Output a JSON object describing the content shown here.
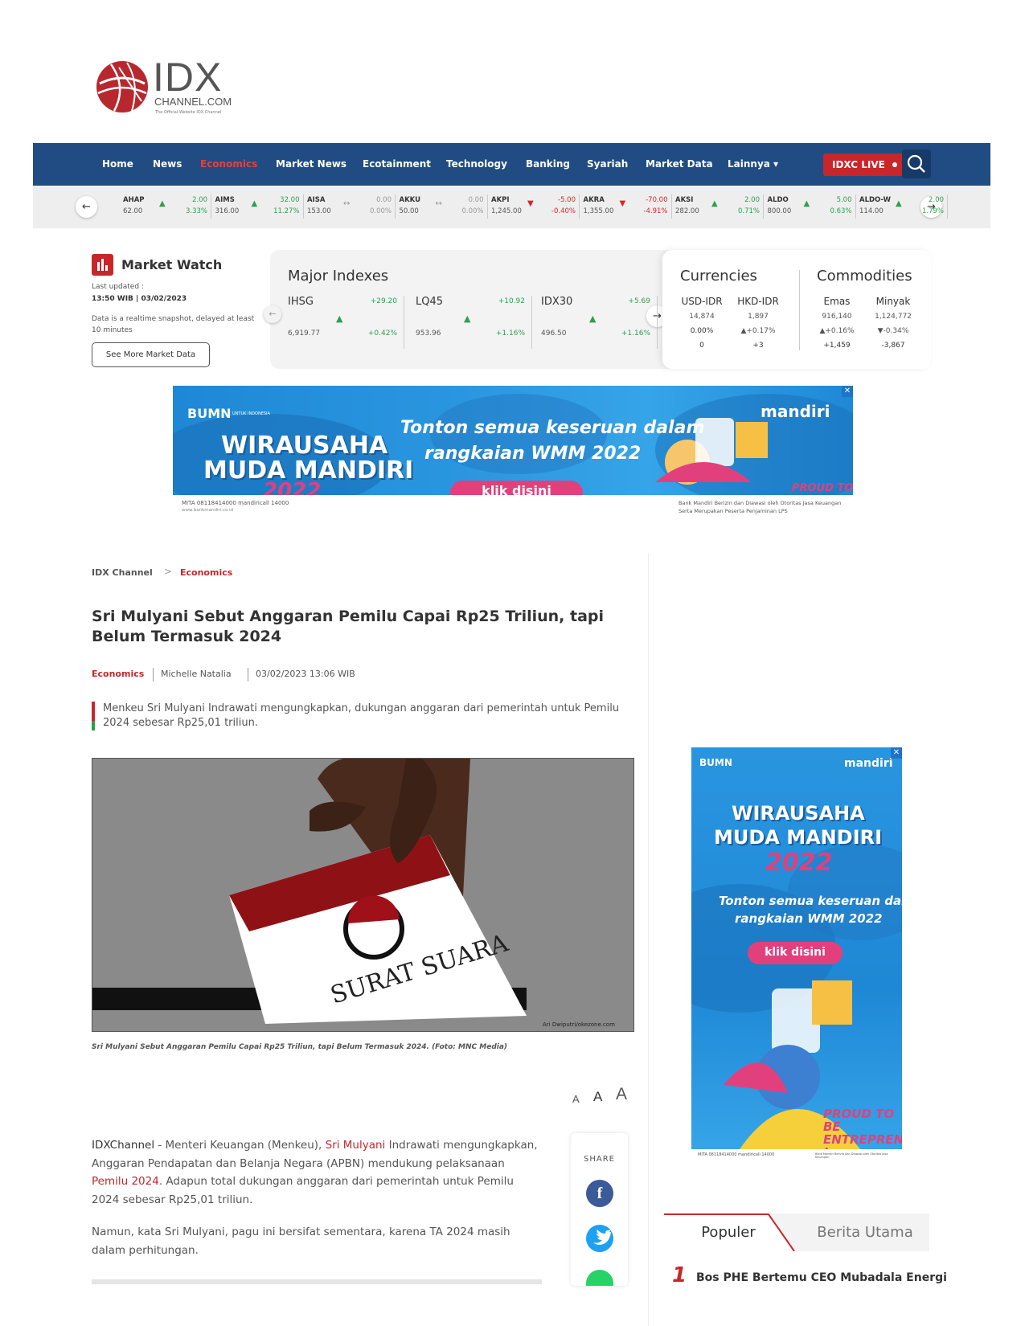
{
  "logo": {
    "main": "IDX",
    "sub": "CHANNEL.COM",
    "tagline": "The Official Website IDX Channel"
  },
  "nav": {
    "items": [
      {
        "label": "Home",
        "active": false
      },
      {
        "label": "News",
        "active": false
      },
      {
        "label": "Economics",
        "active": true
      },
      {
        "label": "Market News",
        "active": false
      },
      {
        "label": "Ecotainment",
        "active": false
      },
      {
        "label": "Technology",
        "active": false
      },
      {
        "label": "Banking",
        "active": false
      },
      {
        "label": "Syariah",
        "active": false
      },
      {
        "label": "Market Data",
        "active": false
      },
      {
        "label": "Lainnya ▾",
        "active": false
      }
    ],
    "live_label": "IDXC LIVE",
    "search_icon": "search-icon"
  },
  "ticker": [
    {
      "code": "AHAP",
      "price": "62.00",
      "change": "2.00",
      "pct": "3.33%",
      "dir": "up"
    },
    {
      "code": "AIMS",
      "price": "316.00",
      "change": "32.00",
      "pct": "11.27%",
      "dir": "up"
    },
    {
      "code": "AISA",
      "price": "153.00",
      "change": "0.00",
      "pct": "0.00%",
      "dir": "flat"
    },
    {
      "code": "AKKU",
      "price": "50.00",
      "change": "0.00",
      "pct": "0.00%",
      "dir": "flat"
    },
    {
      "code": "AKPI",
      "price": "1,245.00",
      "change": "-5.00",
      "pct": "-0.40%",
      "dir": "down"
    },
    {
      "code": "AKRA",
      "price": "1,355.00",
      "change": "-70.00",
      "pct": "-4.91%",
      "dir": "down"
    },
    {
      "code": "AKSI",
      "price": "282.00",
      "change": "2.00",
      "pct": "0.71%",
      "dir": "up"
    },
    {
      "code": "ALDO",
      "price": "800.00",
      "change": "5.00",
      "pct": "0.63%",
      "dir": "up"
    },
    {
      "code": "ALDO-W",
      "price": "114.00",
      "change": "2.00",
      "pct": "1.79%",
      "dir": "up"
    }
  ],
  "market_watch": {
    "title": "Market Watch",
    "last_updated_label": "Last updated :",
    "last_updated": "13:50 WIB | 03/02/2023",
    "note": "Data is a realtime snapshot, delayed at least 10 minutes",
    "button": "See More Market Data"
  },
  "major_indexes": {
    "title": "Major Indexes",
    "items": [
      {
        "name": "IHSG",
        "change": "+29.20",
        "value": "6,919.77",
        "pct": "+0.42%"
      },
      {
        "name": "LQ45",
        "change": "+10.92",
        "value": "953.96",
        "pct": "+1.16%"
      },
      {
        "name": "IDX30",
        "change": "+5.69",
        "value": "496.50",
        "pct": "+1.16%"
      }
    ]
  },
  "currencies": {
    "title": "Currencies",
    "items": [
      {
        "name": "USD-IDR",
        "value": "14,874",
        "pct": "0.00%",
        "change": "0",
        "dir": "flat"
      },
      {
        "name": "HKD-IDR",
        "value": "1,897",
        "pct": "+0.17%",
        "change": "+3",
        "dir": "up"
      }
    ]
  },
  "commodities": {
    "title": "Commodities",
    "items": [
      {
        "name": "Emas",
        "value": "916,140",
        "pct": "+0.16%",
        "change": "+1,459",
        "dir": "up"
      },
      {
        "name": "Minyak",
        "value": "1,124,772",
        "pct": "-0.34%",
        "change": "-3,867",
        "dir": "down"
      }
    ]
  },
  "ad": {
    "brand": "BUMN",
    "brand_sub": "UNTUK INDONESIA",
    "bank": "mandiri",
    "title1": "WIRAUSAHA",
    "title2": "MUDA MANDIRI",
    "year": "2022",
    "tagline1": "Tonton semua keseruan dalam",
    "tagline2": "rangkaian WMM 2022",
    "cta": "klik disini",
    "footer_left": "MITA 08118414000   mandiricall 14000",
    "footer_web": "www.bankmandiri.co.id",
    "footer_right1": "Bank Mandiri Berizin dan Diawasi oleh Otoritas Jasa Keuangan",
    "footer_right2": "Serta Merupakan Peserta Penjaminan LPS",
    "close": "✕",
    "slogan": "PROUD TO BE ENTREPRENEUR !"
  },
  "breadcrumb": {
    "home": "IDX Channel",
    "sep": ">",
    "category": "Economics"
  },
  "article": {
    "title": "Sri Mulyani Sebut Anggaran Pemilu Capai Rp25 Triliun, tapi Belum Termasuk 2024",
    "category": "Economics",
    "author": "Michelle Natalia",
    "date": "03/02/2023 13:06 WIB",
    "lead": "Menkeu Sri Mulyani Indrawati mengungkapkan, dukungan anggaran dari pemerintah untuk Pemilu 2024 sebesar Rp25,01 triliun.",
    "image_text": "SURAT SUARA",
    "image_credit": "Ari Dwiputri/okezone.com",
    "caption": "Sri Mulyani Sebut Anggaran Pemilu Capai Rp25 Triliun, tapi Belum Termasuk 2024. (Foto: MNC Media)",
    "font_sizes": [
      "A",
      "A",
      "A"
    ],
    "p1_source": "IDXChannel",
    "p1_a": " - Menteri Keuangan (Menkeu), ",
    "p1_link1": "Sri Mulyani",
    "p1_b": " Indrawati mengungkapkan, Anggaran Pendapatan dan Belanja Negara (APBN) mendukung pelaksanaan ",
    "p1_link2": "Pemilu 2024",
    "p1_c": ". Adapun total dukungan anggaran dari pemerintah untuk Pemilu 2024 sebesar Rp25,01 triliun.",
    "p2": "Namun, kata Sri Mulyani, pagu ini bersifat sementara, karena TA 2024 masih dalam perhitungan."
  },
  "share": {
    "label": "SHARE",
    "icons": [
      "facebook-icon",
      "twitter-icon",
      "whatsapp-icon"
    ]
  },
  "tabs": {
    "popular": "Populer",
    "headline": "Berita Utama"
  },
  "popular": [
    {
      "rank": "1",
      "title": "Bos PHE Bertemu CEO Mubadala Energi"
    }
  ],
  "colors": {
    "nav": "#204c83",
    "accent": "#c8262a",
    "up": "#2e9e4e",
    "down": "#d3262b"
  }
}
